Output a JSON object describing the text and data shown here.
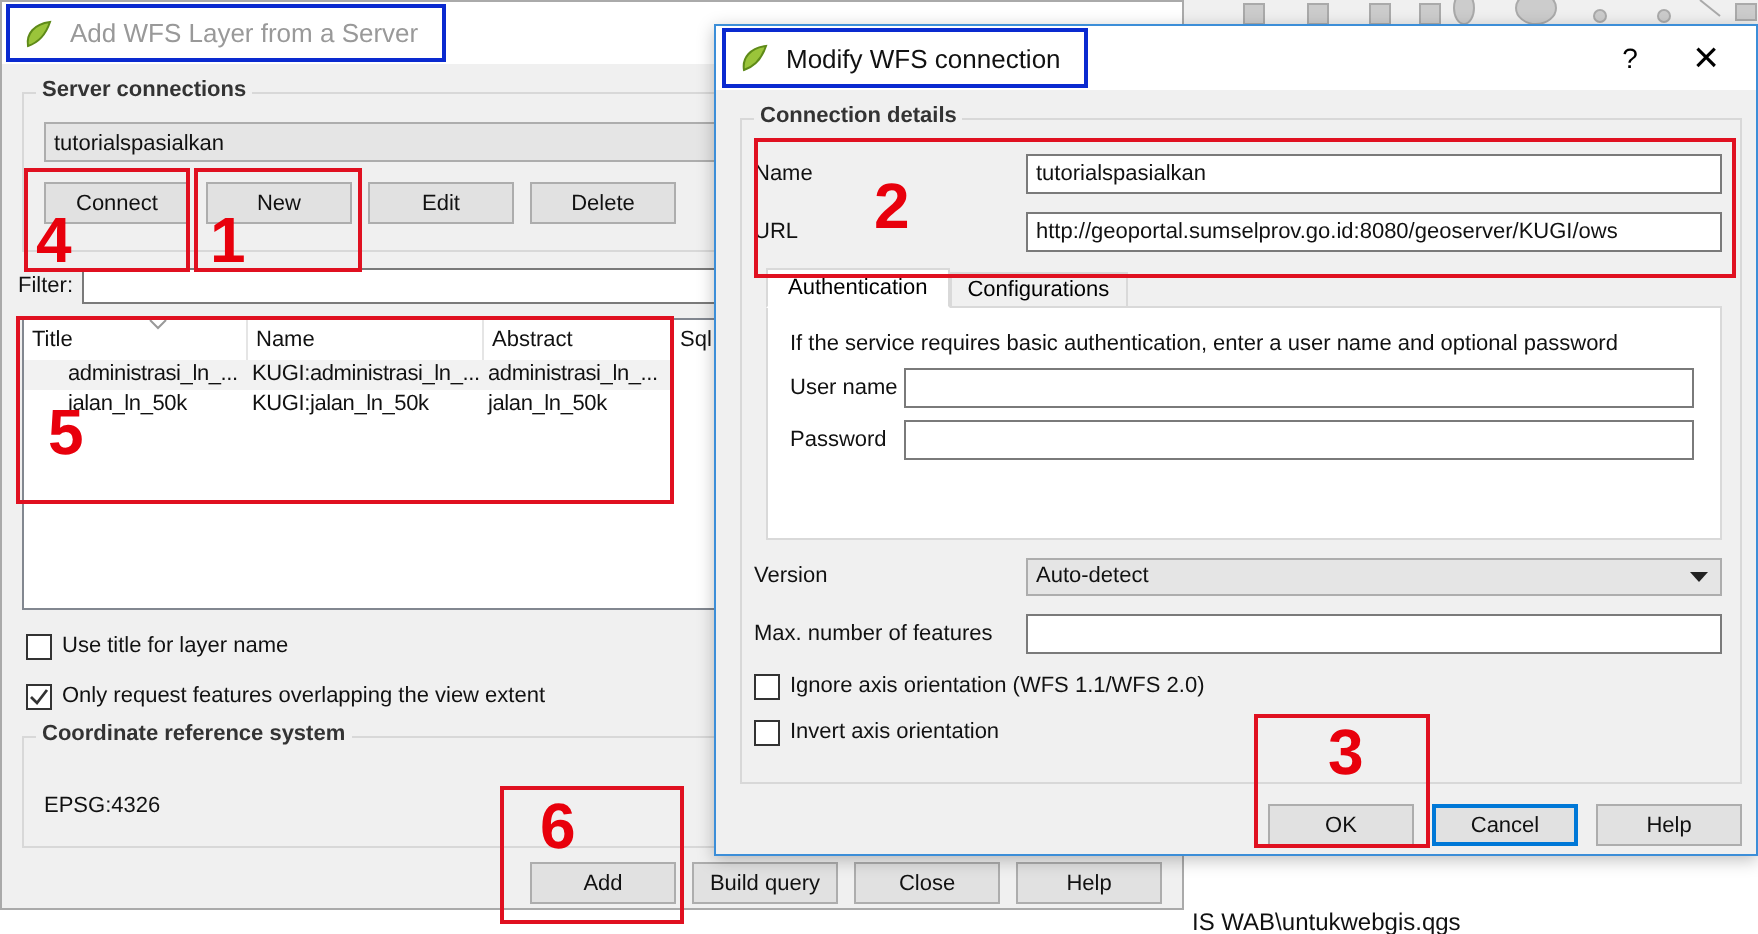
{
  "back_dialog": {
    "title": "Add WFS Layer from a Server",
    "title_highlighted": true,
    "server_connections": {
      "heading": "Server connections",
      "selected_connection": "tutorialspasialkan",
      "buttons": [
        "Connect",
        "New",
        "Edit",
        "Delete"
      ]
    },
    "filter": {
      "label": "Filter:"
    },
    "layers_table": {
      "columns": [
        "Title",
        "Name",
        "Abstract",
        "Sql"
      ],
      "rows": [
        [
          "administrasi_ln_...",
          "KUGI:administrasi_ln_...",
          "administrasi_ln_..."
        ],
        [
          "jalan_ln_50k",
          "KUGI:jalan_ln_50k",
          "jalan_ln_50k"
        ]
      ]
    },
    "options": [
      {
        "label": "Use title for layer name",
        "checked": false
      },
      {
        "label": "Only request features overlapping the view extent",
        "checked": true
      }
    ],
    "crs": {
      "heading": "Coordinate reference system",
      "value": "EPSG:4326"
    },
    "buttons": [
      "Add",
      "Build query",
      "Close",
      "Help"
    ]
  },
  "front_dialog": {
    "title": "Modify WFS connection",
    "title_highlighted": true,
    "help_glyph": "?",
    "close_glyph": "×",
    "connection_details": {
      "heading": "Connection details",
      "fields": [
        {
          "label": "Name",
          "value": "tutorialspasialkan"
        },
        {
          "label": "URL",
          "value": "http://geoportal.sumselprov.go.id:8080/geoserver/KUGI/ows"
        }
      ]
    },
    "tabs": [
      {
        "label": "Authentication",
        "selected": true
      },
      {
        "label": "Configurations",
        "selected": false
      }
    ],
    "authentication": {
      "hint": "If the service requires basic authentication, enter a user name and optional password",
      "fields": [
        {
          "label": "User name"
        },
        {
          "label": "Password"
        }
      ]
    },
    "version": {
      "label": "Version",
      "value": "Auto-detect"
    },
    "max_features": {
      "label": "Max. number of features"
    },
    "options": [
      {
        "label": "Ignore axis orientation (WFS 1.1/WFS 2.0)",
        "checked": false
      },
      {
        "label": "Invert axis orientation",
        "checked": false
      }
    ],
    "buttons": [
      {
        "label": "OK",
        "default": false
      },
      {
        "label": "Cancel",
        "default": true
      },
      {
        "label": "Help",
        "default": false
      }
    ]
  },
  "annotations": [
    {
      "number": "1"
    },
    {
      "number": "2"
    },
    {
      "number": "3"
    },
    {
      "number": "4"
    },
    {
      "number": "5"
    },
    {
      "number": "6"
    }
  ],
  "background_path": "IS WAB\\untukwebgis.qgs"
}
